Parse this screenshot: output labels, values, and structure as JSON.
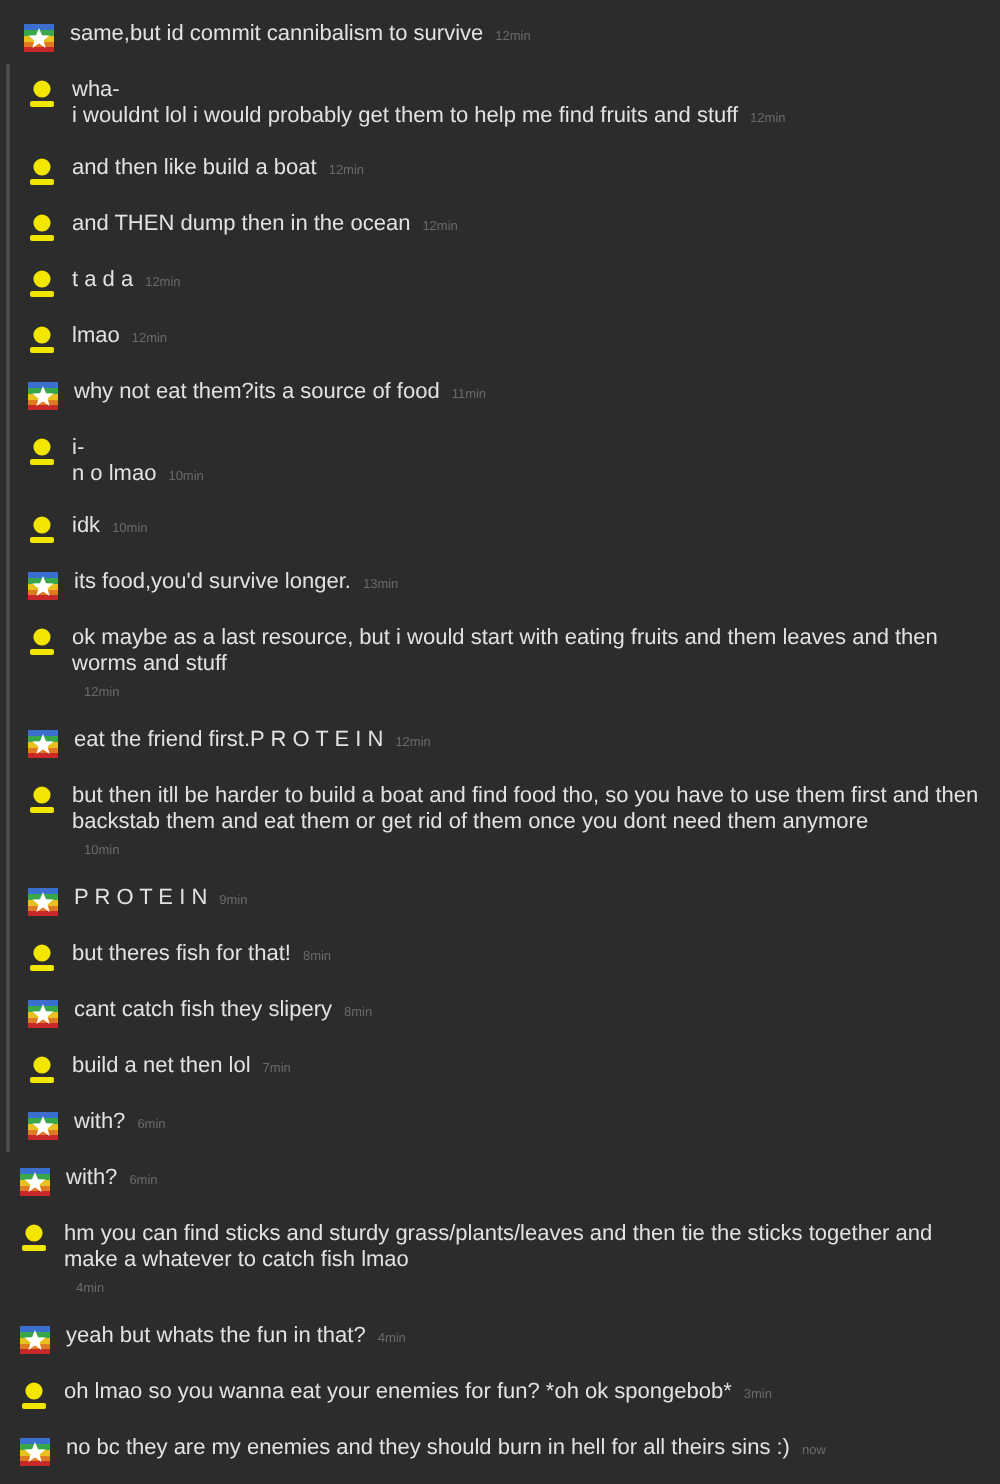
{
  "messages": [
    {
      "kind": "flag",
      "in_thread": false,
      "text": "same,but id commit cannibalism to survive",
      "time": "12min"
    },
    {
      "kind": "person",
      "in_thread": true,
      "text": "wha-\ni wouldnt lol i would probably get them to help me find fruits and stuff",
      "time": "12min"
    },
    {
      "kind": "person",
      "in_thread": true,
      "text": "and then like build a boat",
      "time": "12min"
    },
    {
      "kind": "person",
      "in_thread": true,
      "text": "and THEN dump then in the ocean",
      "time": "12min"
    },
    {
      "kind": "person",
      "in_thread": true,
      "text": "t a d a",
      "time": "12min"
    },
    {
      "kind": "person",
      "in_thread": true,
      "text": "lmao",
      "time": "12min"
    },
    {
      "kind": "flag",
      "in_thread": true,
      "text": "why not eat them?its a source of food",
      "time": "11min"
    },
    {
      "kind": "person",
      "in_thread": true,
      "text": "i-\nn o lmao",
      "time": "10min"
    },
    {
      "kind": "person",
      "in_thread": true,
      "text": "idk",
      "time": "10min"
    },
    {
      "kind": "flag",
      "in_thread": true,
      "text": "its food,you'd survive longer.",
      "time": "13min"
    },
    {
      "kind": "person",
      "in_thread": true,
      "text": "ok maybe as a last resource, but i would start with eating fruits and them leaves and then worms and stuff",
      "time": "12min"
    },
    {
      "kind": "flag",
      "in_thread": true,
      "text": "eat the friend first.P R O T E I N",
      "time": "12min"
    },
    {
      "kind": "person",
      "in_thread": true,
      "text": "but then itll be harder to build a boat and find food tho, so you have to use them first and then backstab them and eat them or get rid of them once you dont need them anymore",
      "time": "10min"
    },
    {
      "kind": "flag",
      "in_thread": true,
      "text": "P R O T E I N",
      "time": "9min"
    },
    {
      "kind": "person",
      "in_thread": true,
      "text": "but theres fish for that!",
      "time": "8min"
    },
    {
      "kind": "flag",
      "in_thread": true,
      "text": "cant catch fish they slipery",
      "time": "8min"
    },
    {
      "kind": "person",
      "in_thread": true,
      "text": "build a net then lol",
      "time": "7min"
    },
    {
      "kind": "flag",
      "in_thread": true,
      "text": "with?",
      "time": "6min"
    },
    {
      "kind": "flag",
      "in_thread": false,
      "text": "with?",
      "time": "6min"
    },
    {
      "kind": "person",
      "in_thread": false,
      "text": "hm you can find sticks and sturdy grass/plants/leaves and then tie the sticks together and make a whatever to catch fish lmao",
      "time": "4min"
    },
    {
      "kind": "flag",
      "in_thread": false,
      "text": "yeah but whats the fun in that?",
      "time": "4min"
    },
    {
      "kind": "person",
      "in_thread": false,
      "text": "oh lmao so you wanna eat your enemies for fun? *oh ok spongebob*",
      "time": "3min"
    },
    {
      "kind": "flag",
      "in_thread": false,
      "text": "no bc they are my enemies and they should burn in hell for all theirs sins :)",
      "time": "now"
    }
  ]
}
